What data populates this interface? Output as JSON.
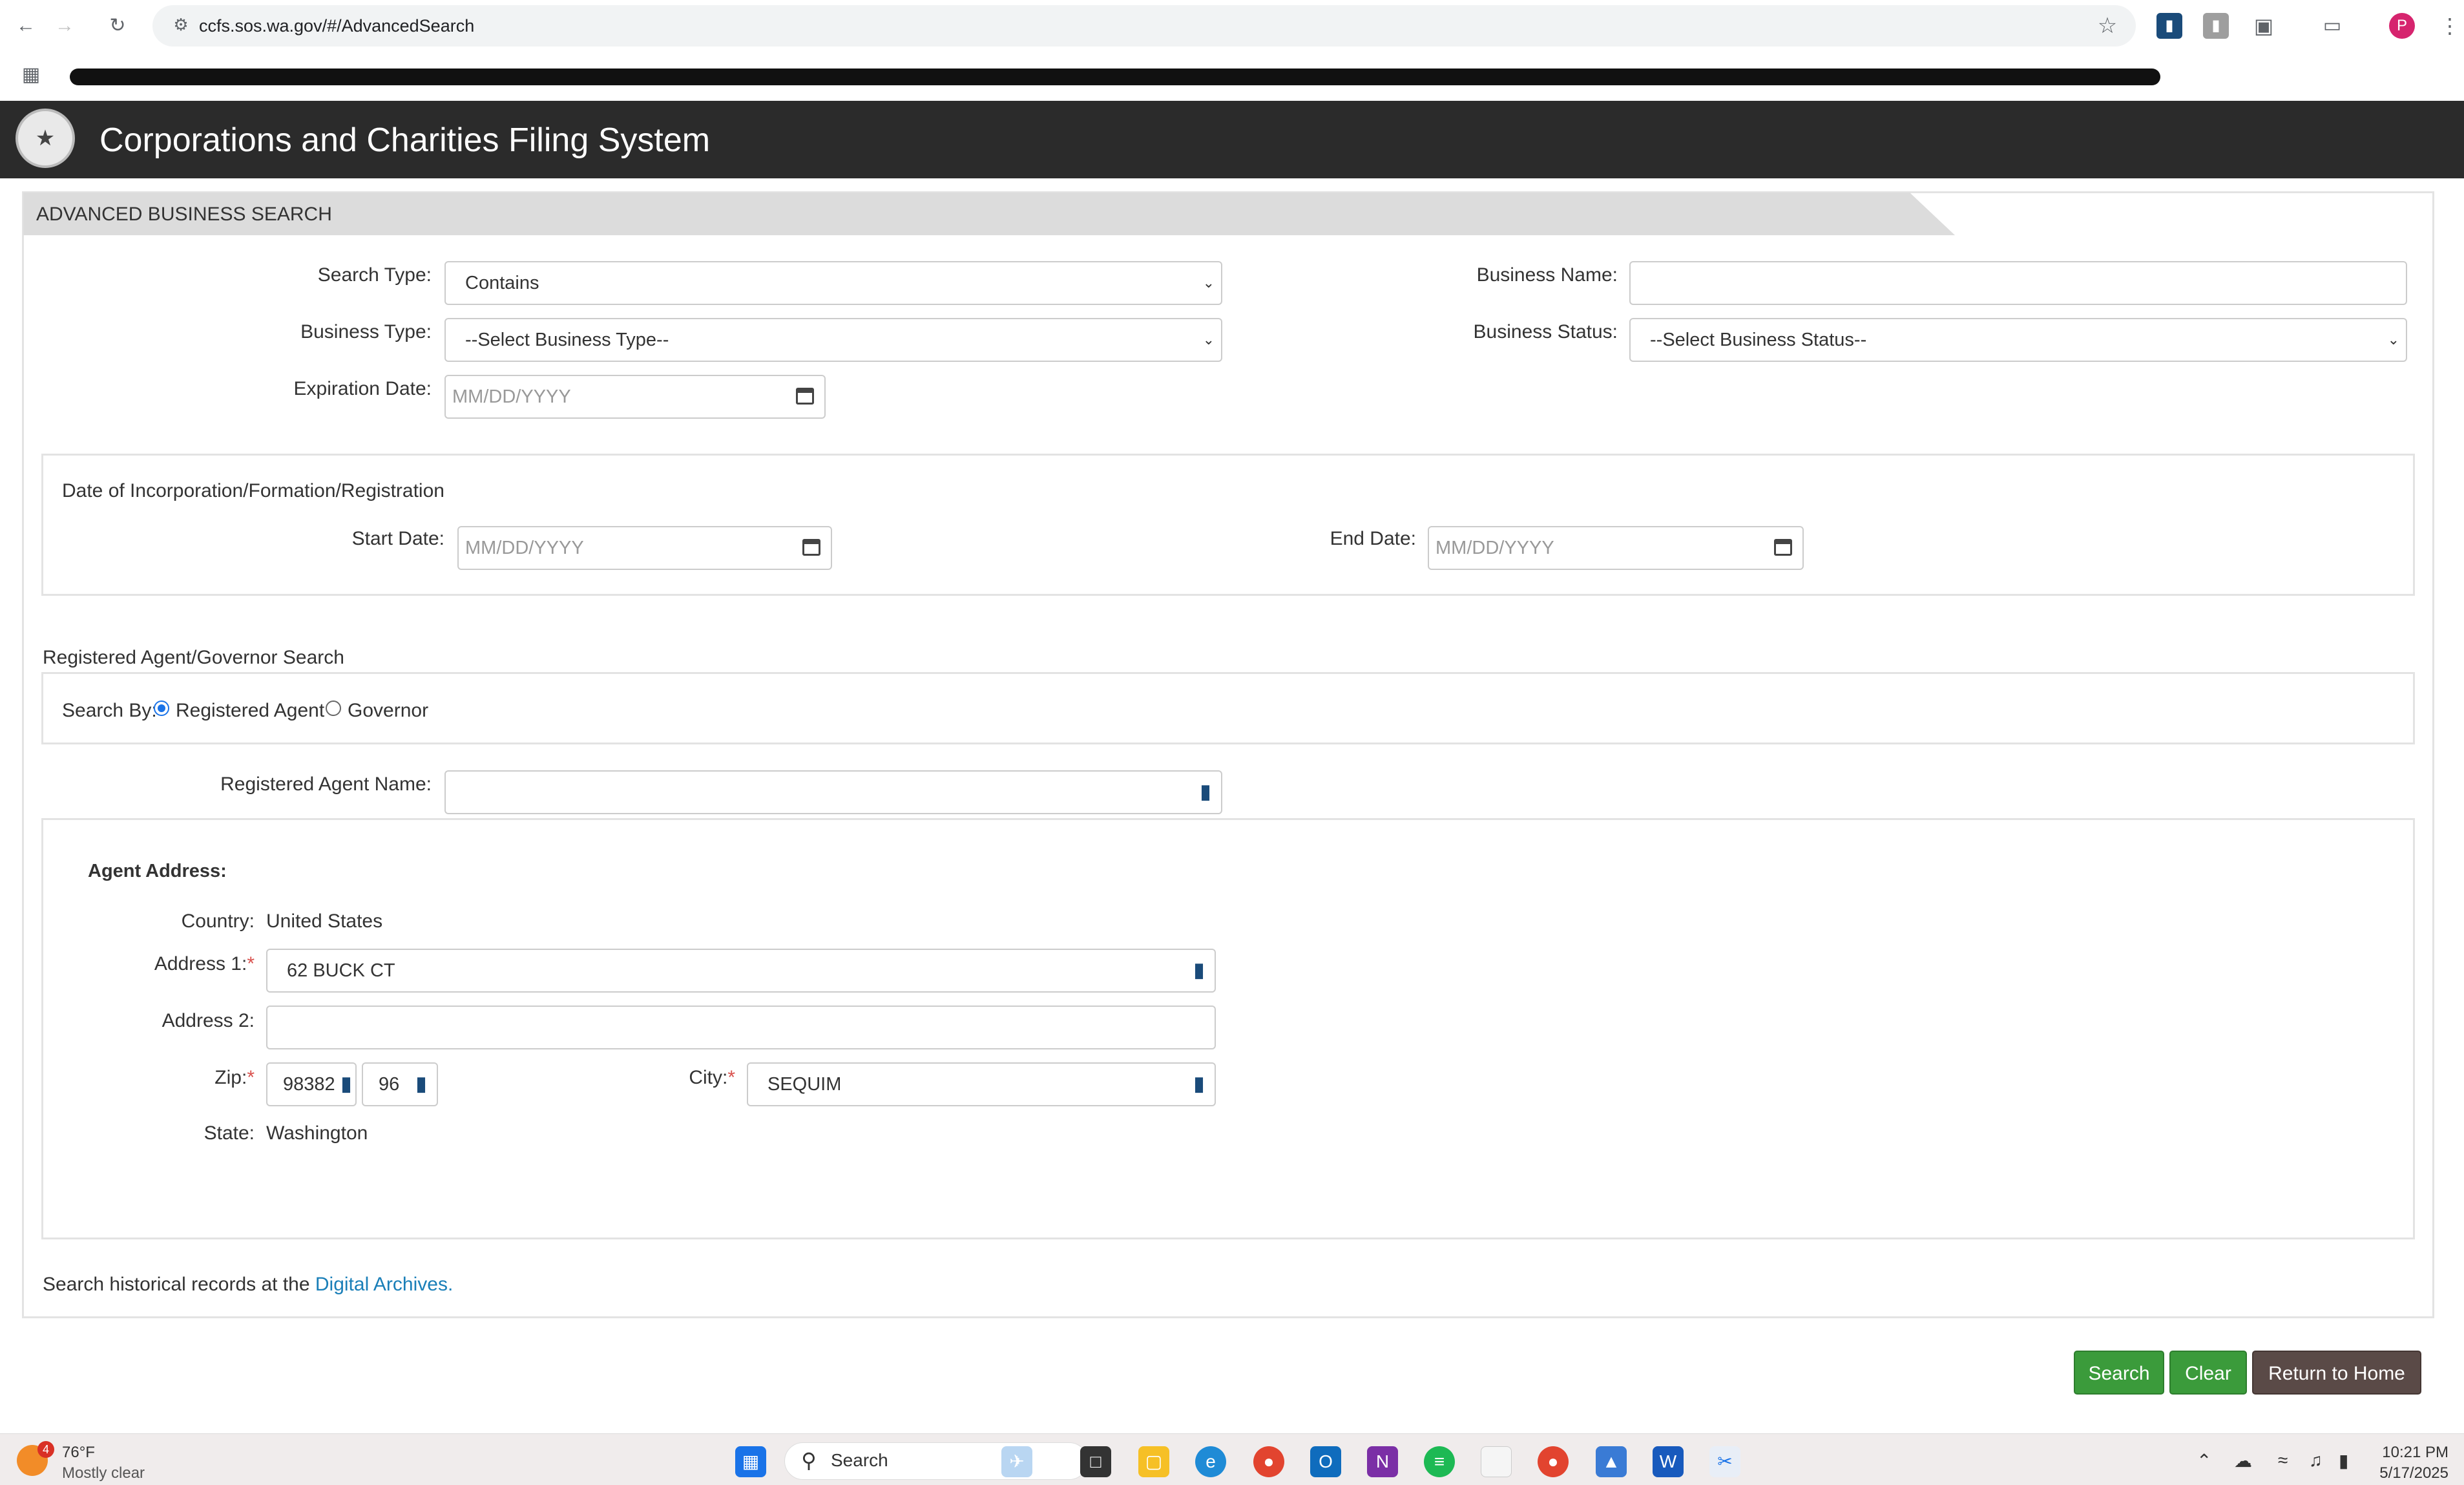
{
  "browser": {
    "url": "ccfs.sos.wa.gov/#/AdvancedSearch",
    "profile_initial": "P"
  },
  "site": {
    "title": "Corporations and Charities Filing System"
  },
  "panel": {
    "heading": "ADVANCED BUSINESS SEARCH"
  },
  "form": {
    "search_type_label": "Search Type:",
    "search_type_value": "Contains",
    "business_name_label": "Business Name:",
    "business_type_label": "Business Type:",
    "business_type_value": "--Select Business Type--",
    "business_status_label": "Business Status:",
    "business_status_value": "--Select Business Status--",
    "expiration_date_label": "Expiration Date:",
    "date_placeholder": "MM/DD/YYYY"
  },
  "incorporation": {
    "title": "Date of Incorporation/Formation/Registration",
    "start_label": "Start Date:",
    "end_label": "End Date:"
  },
  "agent_search": {
    "title": "Registered Agent/Governor Search",
    "search_by_label": "Search By:",
    "option_agent": "Registered Agent",
    "option_governor": "Governor",
    "selected": "Registered Agent",
    "agent_name_label": "Registered Agent Name:"
  },
  "address": {
    "title": "Agent Address:",
    "country_label": "Country:",
    "country_value": "United States",
    "address1_label": "Address 1:",
    "address1_value": "62 BUCK CT",
    "address2_label": "Address 2:",
    "zip_label": "Zip:",
    "zip_value": "98382",
    "zip_ext_value": "96",
    "city_label": "City:",
    "city_value": "SEQUIM",
    "state_label": "State:",
    "state_value": "Washington",
    "required_mark": "*"
  },
  "footer_note": {
    "text": "Search historical records at the ",
    "link": "Digital Archives."
  },
  "buttons": {
    "search": "Search",
    "clear": "Clear",
    "return_home": "Return to Home"
  },
  "taskbar": {
    "weather_badge": "4",
    "temperature": "76°F",
    "condition": "Mostly clear",
    "search_label": "Search",
    "time": "10:21 PM",
    "date": "5/17/2025"
  }
}
